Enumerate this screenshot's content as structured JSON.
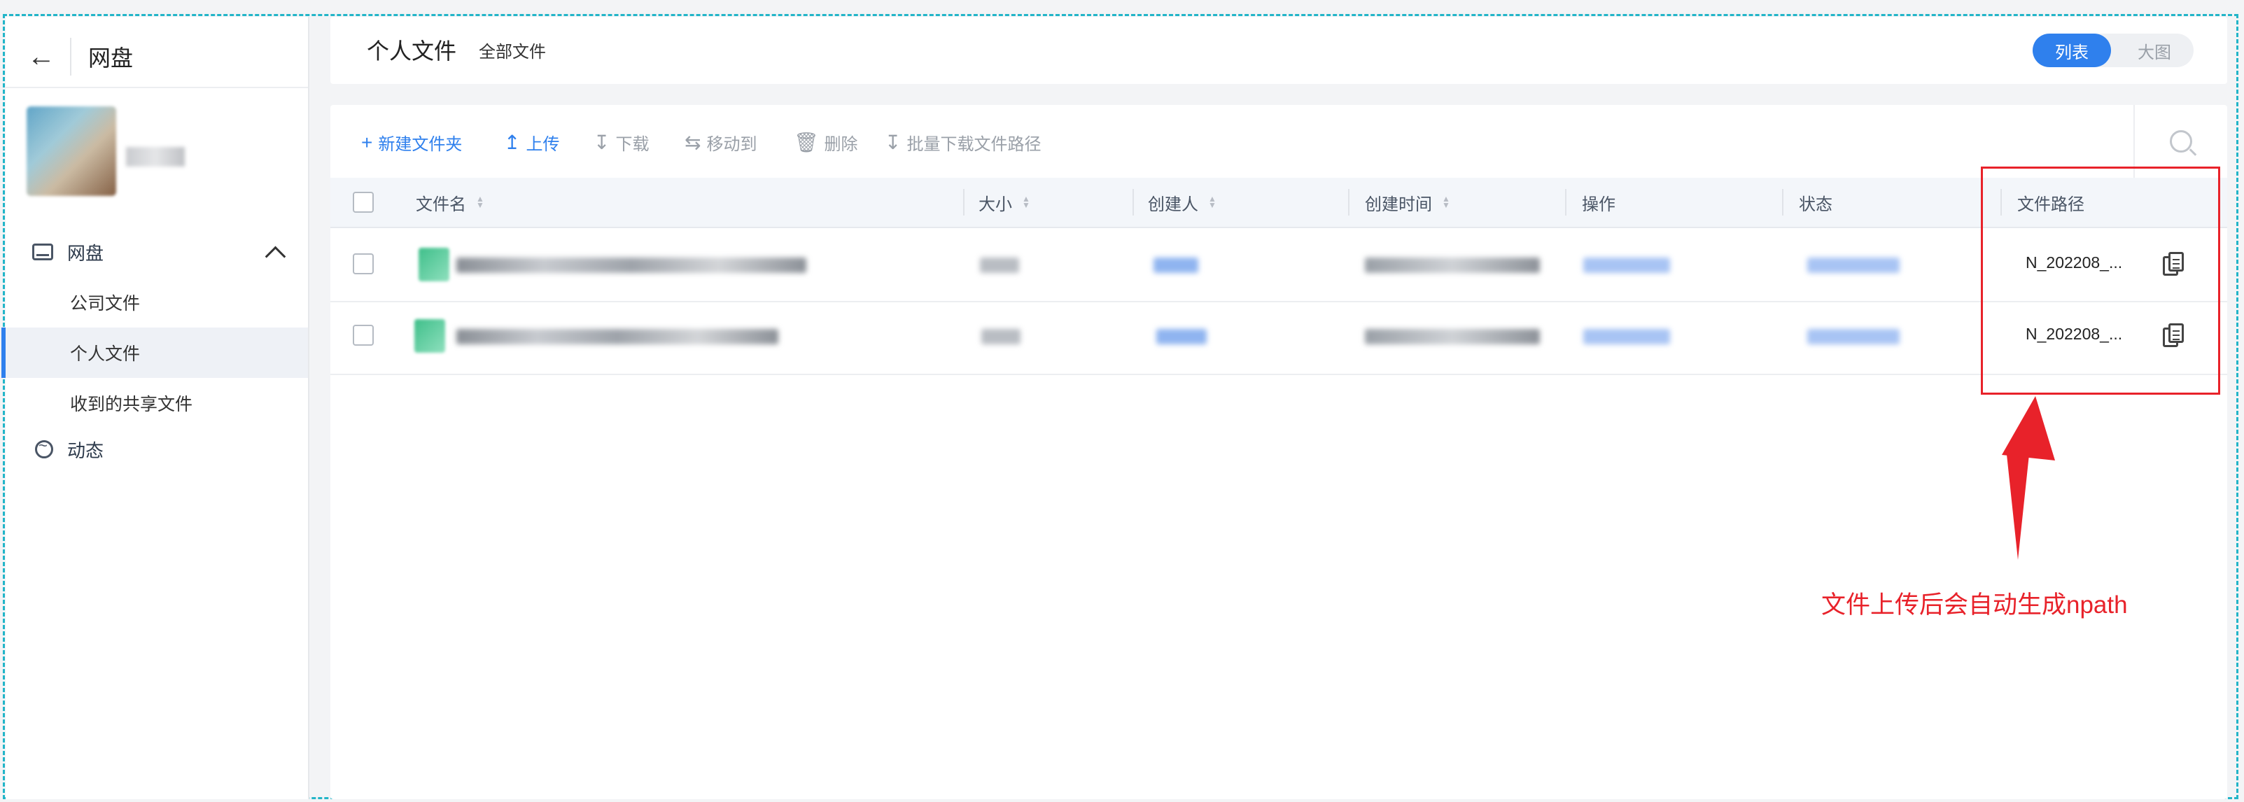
{
  "sidebar": {
    "title": "网盘",
    "nav": {
      "group_label": "网盘",
      "items": [
        {
          "label": "公司文件"
        },
        {
          "label": "个人文件"
        },
        {
          "label": "收到的共享文件"
        }
      ],
      "activity_label": "动态"
    }
  },
  "header": {
    "title": "个人文件",
    "breadcrumb": "全部文件",
    "view_toggle": {
      "list": "列表",
      "grid": "大图",
      "selected": "列表"
    }
  },
  "toolbar": {
    "new_folder": "新建文件夹",
    "upload": "上传",
    "download": "下载",
    "move_to": "移动到",
    "delete": "删除",
    "batch_download_path": "批量下载文件路径"
  },
  "table": {
    "columns": [
      "文件名",
      "大小",
      "创建人",
      "创建时间",
      "操作",
      "状态",
      "文件路径"
    ],
    "rows": [
      {
        "path": "N_202208_..."
      },
      {
        "path": "N_202208_..."
      }
    ]
  },
  "annotation": {
    "text": "文件上传后会自动生成npath",
    "color": "#e8222a"
  },
  "colors": {
    "accent": "#2f80ed",
    "frame": "#22b5c8"
  }
}
